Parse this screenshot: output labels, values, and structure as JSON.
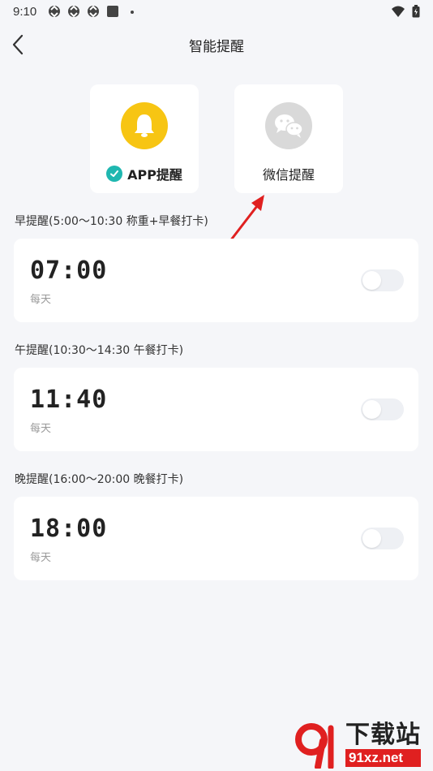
{
  "status_bar": {
    "time": "9:10"
  },
  "header": {
    "title": "智能提醒"
  },
  "reminder_types": {
    "app": {
      "label": "APP提醒",
      "selected": true
    },
    "wechat": {
      "label": "微信提醒",
      "selected": false
    }
  },
  "sections": [
    {
      "label": "早提醒(5:00～10:30 称重+早餐打卡)",
      "time": "07:00",
      "repeat": "每天",
      "enabled": false
    },
    {
      "label": "午提醒(10:30～14:30 午餐打卡)",
      "time": "11:40",
      "repeat": "每天",
      "enabled": false
    },
    {
      "label": "晚提醒(16:00～20:00 晚餐打卡)",
      "time": "18:00",
      "repeat": "每天",
      "enabled": false
    }
  ],
  "watermark": {
    "brand_cn": "下载站",
    "brand_en": "91xz.net"
  },
  "colors": {
    "background": "#f5f6f9",
    "accent_teal": "#1fb7b0",
    "bell_yellow": "#f7c513",
    "wechat_grey": "#d9d9d9",
    "toggle_off": "#eef0f4",
    "annotation_red": "#e02020"
  },
  "icons": {
    "back": "chevron-left-icon",
    "app": "bell-icon",
    "wechat": "wechat-icon",
    "check": "check-circle-icon"
  }
}
